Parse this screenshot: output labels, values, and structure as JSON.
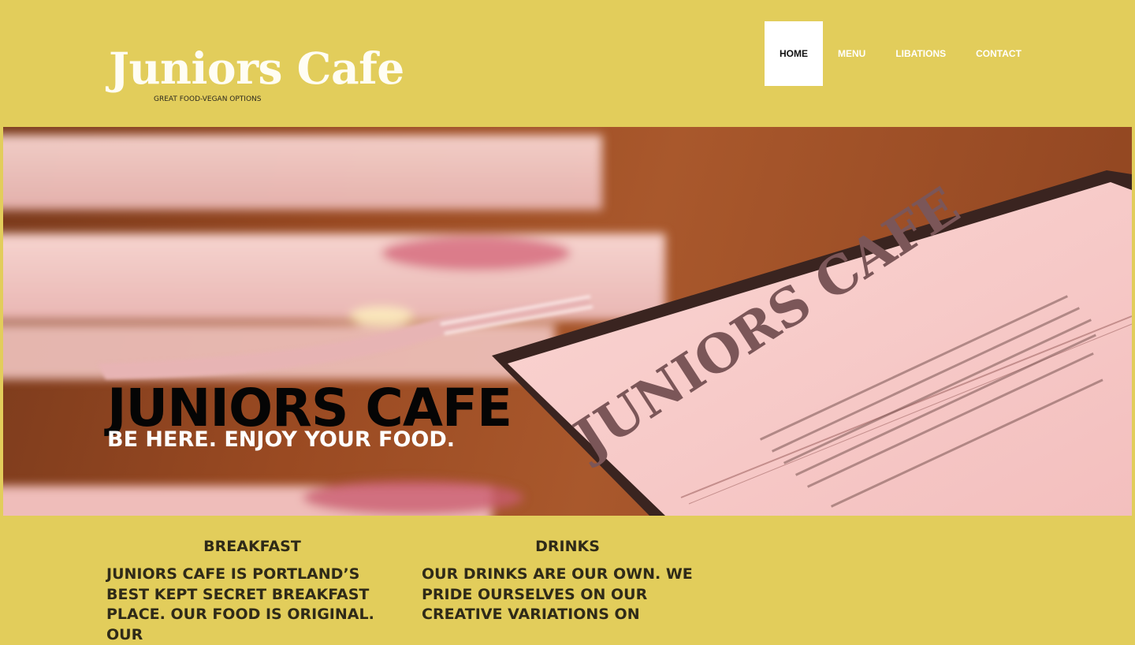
{
  "brand": {
    "title": "Juniors Cafe",
    "tagline": "GREAT FOOD-VEGAN OPTIONS"
  },
  "nav": {
    "items": [
      {
        "label": "HOME",
        "active": true
      },
      {
        "label": "MENU",
        "active": false
      },
      {
        "label": "LIBATIONS",
        "active": false
      },
      {
        "label": "CONTACT",
        "active": false
      }
    ]
  },
  "hero": {
    "title": "JUNIORS CAFE",
    "subtitle": "BE HERE. ENJOY YOUR FOOD.",
    "menu_card_text": "JUNIORS CAFE"
  },
  "columns": [
    {
      "heading": "BREAKFAST",
      "body": "JUNIORS CAFE IS PORTLAND’S BEST KEPT SECRET BREAKFAST PLACE. OUR FOOD IS ORIGINAL. OUR"
    },
    {
      "heading": "DRINKS",
      "body": "OUR DRINKS ARE OUR OWN. WE PRIDE OURSELVES ON OUR CREATIVE VARIATIONS ON"
    }
  ],
  "colors": {
    "background": "#e2cd5b",
    "nav_text": "#ffffff",
    "nav_active_bg": "#ffffff",
    "body_text": "#2f2a18"
  }
}
